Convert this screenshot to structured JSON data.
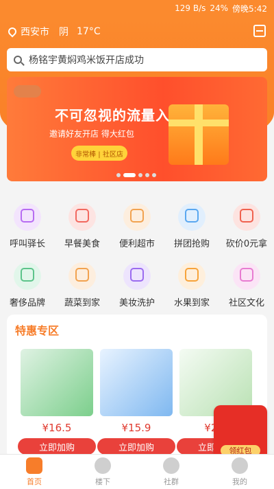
{
  "status_bar": {
    "network": "129 B/s",
    "battery": "24%",
    "time": "傍晚5:42"
  },
  "header": {
    "city": "西安市",
    "weather": "阴",
    "temperature": "17°C"
  },
  "search": {
    "text": "杨铭宇黄焖鸡米饭开店成功"
  },
  "banner": {
    "title": "不可忽视的流量入口",
    "subtitle": "邀请好友开店 得大红包",
    "button": "非常棒 | 社区店"
  },
  "categories": [
    {
      "label": "呼叫驿长",
      "icon": "person-icon",
      "color": "#b76bf2"
    },
    {
      "label": "早餐美食",
      "icon": "flame-icon",
      "color": "#f2685f"
    },
    {
      "label": "便利超市",
      "icon": "store-icon",
      "color": "#f2a24f"
    },
    {
      "label": "拼团抢购",
      "icon": "tag-icon",
      "color": "#59a7f0"
    },
    {
      "label": "砍价0元拿",
      "icon": "ticket-icon",
      "color": "#f0614e"
    },
    {
      "label": "奢侈品牌",
      "icon": "watch-icon",
      "color": "#5cc48a"
    },
    {
      "label": "蔬菜到家",
      "icon": "card-icon",
      "color": "#f2a24f"
    },
    {
      "label": "美妆洗护",
      "icon": "bottle-icon",
      "color": "#9b6af0"
    },
    {
      "label": "水果到家",
      "icon": "clock-icon",
      "color": "#f7a33a"
    },
    {
      "label": "社区文化",
      "icon": "ribbon-icon",
      "color": "#e87bd1"
    }
  ],
  "special": {
    "title": "特惠专区",
    "items": [
      {
        "price": "¥16.5",
        "button": "立即加购"
      },
      {
        "price": "¥15.9",
        "button": "立即加购"
      },
      {
        "price": "¥21.",
        "button": "立即加购"
      }
    ]
  },
  "redpack": {
    "label": "领红包"
  },
  "tabbar": [
    {
      "label": "首页",
      "icon": "home-icon",
      "active": true
    },
    {
      "label": "楼下",
      "icon": "location-icon",
      "active": false
    },
    {
      "label": "社群",
      "icon": "chat-icon",
      "active": false
    },
    {
      "label": "我的",
      "icon": "user-icon",
      "active": false
    }
  ]
}
